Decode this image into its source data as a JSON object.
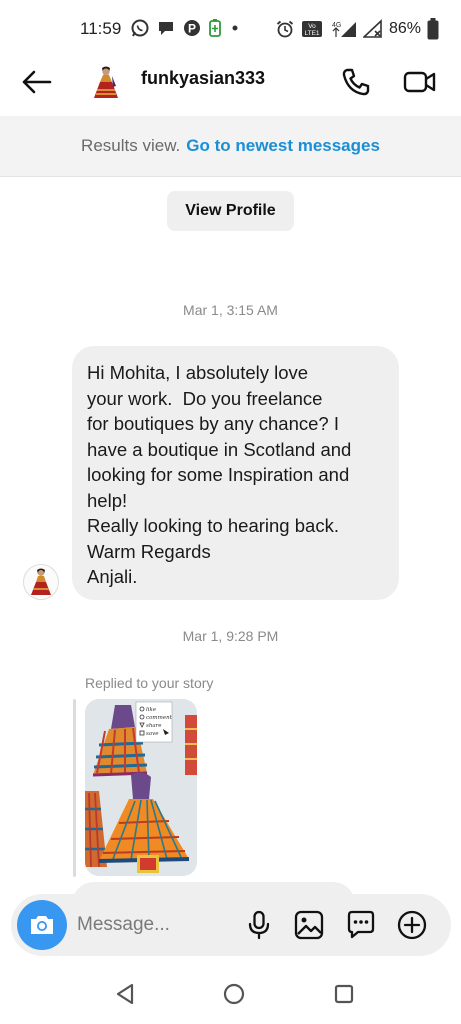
{
  "status_bar": {
    "time": "11:59",
    "battery_percent": "86%",
    "network": "4G",
    "volte": "Vo LTE1",
    "icons": [
      "whatsapp-icon",
      "chat-icon",
      "pinterest-icon",
      "battery-saver-icon",
      "dot-icon",
      "alarm-icon",
      "volte-icon",
      "signal-icon",
      "signal-x-icon",
      "battery-icon"
    ]
  },
  "header": {
    "username": "funkyasian333",
    "icons": [
      "back-arrow-icon",
      "phone-icon",
      "video-camera-icon"
    ]
  },
  "results_banner": {
    "label": "Results view.",
    "link": "Go to newest messages",
    "link_color": "#1a8fd6"
  },
  "view_profile_label": "View Profile",
  "messages": {
    "timestamp_1": "Mar 1, 3:15 AM",
    "message_1": "Hi Mohita, I absolutely love\nyour work.  Do you freelance\nfor boutiques by any chance? I\nhave a boutique in Scotland and\nlooking for some Inspiration and\nhelp!\nReally looking to hearing back.\nWarm Regards\nAnjali.",
    "timestamp_2": "Mar 1, 9:28 PM",
    "reply_label": "Replied to your story",
    "story_image": "lehenga-sketch-illustrations",
    "story_checklist": [
      "like",
      "comment",
      "share",
      "save"
    ]
  },
  "composer": {
    "placeholder": "Message...",
    "camera_color": "#3897f0",
    "icons": [
      "camera-icon",
      "microphone-icon",
      "gallery-icon",
      "sticker-chat-icon",
      "plus-circle-icon"
    ]
  },
  "nav_bar": {
    "icons": [
      "nav-back-icon",
      "nav-home-icon",
      "nav-recents-icon"
    ]
  }
}
